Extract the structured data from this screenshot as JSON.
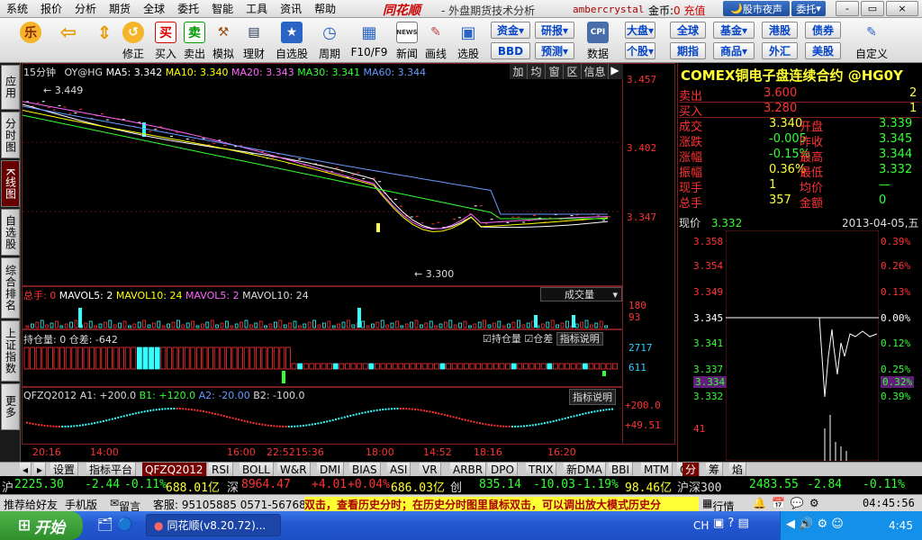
{
  "menu": [
    "系统",
    "报价",
    "分析",
    "期货",
    "全球",
    "委托",
    "智能",
    "工具",
    "资讯",
    "帮助"
  ],
  "brand": "同花顺",
  "app_title": "- 外盘期货技术分析",
  "user": "ambercrystal",
  "gold_label": "金币:",
  "gold_value": "0",
  "recharge": "充值",
  "night_button": "股市夜声",
  "trade_button": "委托",
  "window_controls": [
    "-",
    "▭",
    "×"
  ],
  "toolbar_buttons": [
    {
      "label": "",
      "icon": "乐"
    },
    {
      "label": "",
      "icon": "⇦"
    },
    {
      "label": "",
      "icon": "⇕"
    },
    {
      "label": "修正",
      "icon": "↺"
    },
    {
      "label": "买入",
      "icon": "买"
    },
    {
      "label": "卖出",
      "icon": "卖"
    },
    {
      "label": "模拟",
      "icon": "⚒"
    },
    {
      "label": "理财",
      "icon": "▤"
    },
    {
      "label": "自选股",
      "icon": "★"
    },
    {
      "label": "周期",
      "icon": "◷"
    },
    {
      "label": "F10/F9",
      "icon": "▦"
    },
    {
      "label": "新闻",
      "icon": "NEWS"
    },
    {
      "label": "画线",
      "icon": "✎"
    },
    {
      "label": "选股",
      "icon": "▣"
    },
    {
      "label": "数据",
      "icon": "CPI"
    },
    {
      "label": "自定义",
      "icon": "✎"
    }
  ],
  "toolbar_small": [
    "资金",
    "BBD",
    "研报",
    "预测",
    "大盘",
    "个股",
    "全球",
    "期指",
    "基金",
    "商品",
    "港股",
    "外汇",
    "债券",
    "美股"
  ],
  "left_tabs": [
    "应用",
    "分时图",
    "K线图",
    "自选股",
    "综合排名",
    "上证指数",
    "更多"
  ],
  "chart_header": {
    "period": "15分钟",
    "symbol": "OY@HG",
    "ma5": "MA5: 3.342",
    "ma10": "MA10: 3.340",
    "ma20": "MA20: 3.343",
    "ma30": "MA30: 3.341",
    "ma60": "MA60: 3.344",
    "buttons": [
      "加",
      "均",
      "窗",
      "区",
      "信息"
    ]
  },
  "price_axis": [
    "3.457",
    "3.402",
    "3.347"
  ],
  "price_marks": {
    "high": "3.449",
    "low": "3.300"
  },
  "volume_panel": {
    "legend_total": "总手: 0",
    "legend_mavol5": "MAVOL5: 2",
    "legend_mavol10": "MAVOL10: 24",
    "legend_mavol5b": "MAVOL5: 2",
    "legend_mavol10b": "MAVOL10: 24",
    "dropdown": "成交量",
    "axis": [
      "180",
      "93"
    ]
  },
  "oi_panel": {
    "legend": "持仓量: 0 仓差: -642",
    "check1": "持仓量",
    "check2": "仓差",
    "help": "指标说明",
    "axis": [
      "2717",
      "611"
    ]
  },
  "qfzq_panel": {
    "legend_name": "QFZQ2012",
    "a1": "A1: +200.0",
    "b1": "B1: +120.0",
    "a2": "A2: -20.00",
    "b2": "B2: -100.0",
    "help": "指标说明",
    "axis": [
      "+200.0",
      "+49.51"
    ]
  },
  "time_axis": [
    "20:16",
    "14:00",
    "16:00",
    "22:52",
    "15:36",
    "18:00",
    "14:52",
    "18:16",
    "16:20"
  ],
  "quote": {
    "title": "COMEX铜电子盘连续合约 @HG0Y",
    "rows": [
      {
        "l": "卖出",
        "v": "3.600",
        "v2": "2",
        "lc": "#f33",
        "vc": "#f33",
        "v2c": "#ff3"
      },
      {
        "l": "买入",
        "v": "3.280",
        "v2": "1",
        "lc": "#f33",
        "vc": "#f33",
        "v2c": "#ff3"
      }
    ],
    "stats": [
      {
        "l1": "成交",
        "v1": "3.340",
        "l2": "开盘",
        "v2": "3.339"
      },
      {
        "l1": "涨跌",
        "v1": "-0.005",
        "l2": "昨收",
        "v2": "3.345"
      },
      {
        "l1": "涨幅",
        "v1": "-0.15%",
        "l2": "最高",
        "v2": "3.344"
      },
      {
        "l1": "振幅",
        "v1": "0.36%",
        "l2": "最低",
        "v2": "3.332"
      },
      {
        "l1": "现手",
        "v1": "1",
        "l2": "均价",
        "v2": "—"
      },
      {
        "l1": "总手",
        "v1": "357",
        "l2": "金额",
        "v2": "0"
      }
    ]
  },
  "intraday": {
    "price_label": "现价",
    "price_value": "3.332",
    "date": "2013-04-05,五",
    "left_axis": [
      "3.358",
      "3.354",
      "3.349",
      "3.345",
      "3.341",
      "3.337",
      "3.334",
      "3.332",
      "41"
    ],
    "right_axis": [
      "0.39%",
      "0.26%",
      "0.13%",
      "0.00%",
      "0.12%",
      "0.25%",
      "0.32%",
      "0.39%"
    ]
  },
  "bottom_tabs": [
    "设置",
    "指标平台",
    "QFZQ2012",
    "RSI",
    "BOLL",
    "W&R",
    "DMI",
    "BIAS",
    "ASI",
    "VR",
    "ARBR",
    "DPO",
    "TRIX",
    "新DMA",
    "BBI",
    "MTM",
    "O"
  ],
  "right_bottom_tabs": [
    "分",
    "筹",
    "焰"
  ],
  "ticker": {
    "sh_label": "沪",
    "sh_val": "2225.30",
    "sh_chg": "-2.44",
    "sh_pct": "-0.11%",
    "sh_amt": "688.01亿",
    "sz_label": "深",
    "sz_val": "8964.47",
    "sz_chg": "+4.01",
    "sz_pct": "+0.04%",
    "sz_amt": "686.03亿",
    "cy_label": "创",
    "cy_val": "835.14",
    "cy_chg": "-10.03",
    "cy_pct": "-1.19%",
    "cy_amt": "98.46亿",
    "hs_label": "沪深300",
    "hs_val": "2483.55",
    "hs_chg": "-2.84",
    "hs_pct": "-0.11%"
  },
  "statusbar": {
    "recommend": "推荐给好友",
    "mobile": "手机版",
    "message": "留言",
    "service": "客服: 95105885 0571-56768888",
    "scroll": "双击，查看历史分时；在历史分时图里鼠标双击，可以调出放大模式历史分",
    "quotes": "行情",
    "time": "04:45:56"
  },
  "taskbar": {
    "start": "开始",
    "task": "同花顺(v8.20.72)...",
    "lang": "CH",
    "clock": "4:45"
  },
  "colors": {
    "up": "#ff3333",
    "down": "#33ffff",
    "ma5": "#ffffff",
    "ma10": "#ffff00",
    "ma20": "#ff66ff",
    "ma30": "#33ff33",
    "ma60": "#6699ff"
  }
}
